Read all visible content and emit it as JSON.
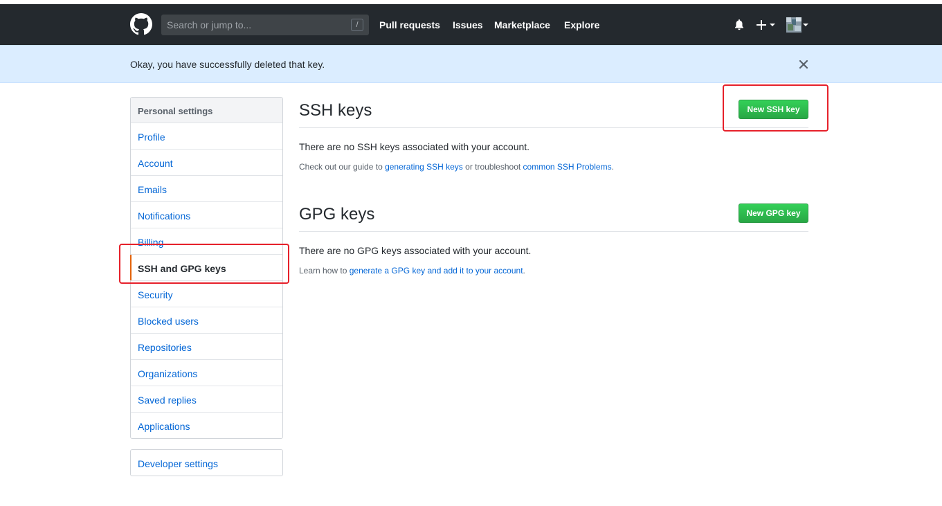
{
  "header": {
    "search_placeholder": "Search or jump to...",
    "search_shortcut": "/",
    "nav": [
      "Pull requests",
      "Issues",
      "Marketplace",
      "Explore"
    ]
  },
  "flash": {
    "message": "Okay, you have successfully deleted that key."
  },
  "sidebar": {
    "heading": "Personal settings",
    "items": [
      {
        "label": "Profile"
      },
      {
        "label": "Account"
      },
      {
        "label": "Emails"
      },
      {
        "label": "Notifications"
      },
      {
        "label": "Billing"
      },
      {
        "label": "SSH and GPG keys",
        "selected": true
      },
      {
        "label": "Security"
      },
      {
        "label": "Blocked users"
      },
      {
        "label": "Repositories"
      },
      {
        "label": "Organizations"
      },
      {
        "label": "Saved replies"
      },
      {
        "label": "Applications"
      }
    ],
    "developer_settings": "Developer settings"
  },
  "ssh": {
    "title": "SSH keys",
    "button": "New SSH key",
    "empty": "There are no SSH keys associated with your account.",
    "note_prefix": "Check out our guide to ",
    "note_link1": "generating SSH keys",
    "note_mid": " or troubleshoot ",
    "note_link2": "common SSH Problems",
    "note_suffix": "."
  },
  "gpg": {
    "title": "GPG keys",
    "button": "New GPG key",
    "empty": "There are no GPG keys associated with your account.",
    "note_prefix": "Learn how to ",
    "note_link": "generate a GPG key and add it to your account",
    "note_suffix": "."
  },
  "colors": {
    "header_bg": "#24292e",
    "flash_bg": "#dbedff",
    "link": "#0366d6",
    "button_green": "#28a745",
    "selected_marker": "#e36209",
    "annotation_red": "#e6202a"
  },
  "icons": {
    "logo": "github-octocat-icon",
    "bell": "bell-icon",
    "plus": "plus-icon",
    "avatar": "avatar",
    "close": "close-icon"
  }
}
